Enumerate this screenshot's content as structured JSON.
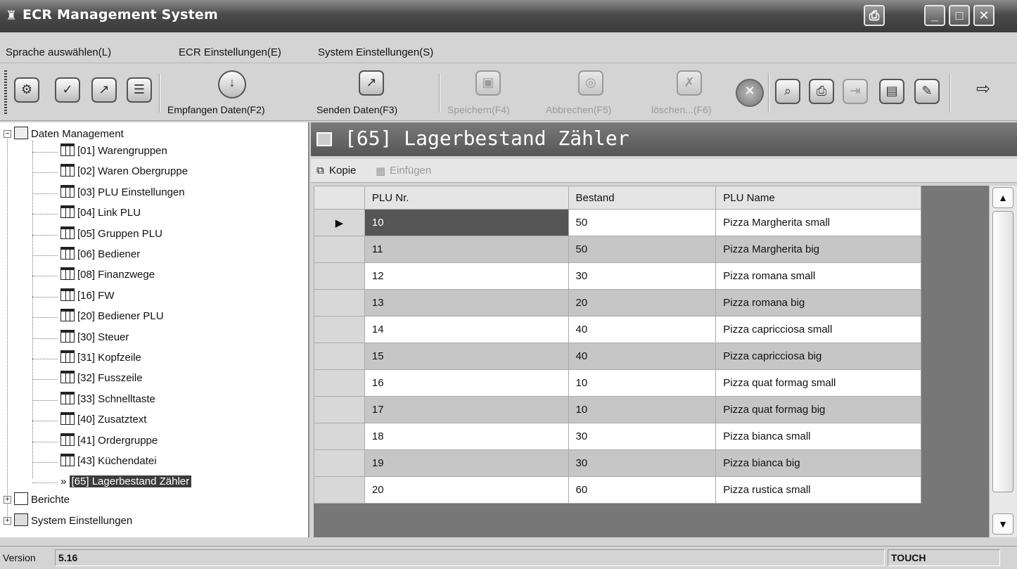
{
  "window": {
    "title": "ECR Management System"
  },
  "menu": [
    "Sprache auswählen(L)",
    "ECR Einstellungen(E)",
    "System Einstellungen(S)"
  ],
  "toolbar": {
    "receive_label": "Empfangen Daten(F2)",
    "send_label": "Senden Daten(F3)",
    "save_label": "Speichern(F4)",
    "cancel_label": "Abbrechen(F5)",
    "delete_label": "löschen...(F6)"
  },
  "tree": {
    "root_label": "Daten Management",
    "items": [
      "[01] Warengruppen",
      "[02] Waren Obergruppe",
      "[03] PLU Einstellungen",
      "[04] Link PLU",
      "[05] Gruppen PLU",
      "[06] Bediener",
      "[08] Finanzwege",
      "[16] FW",
      "[20] Bediener PLU",
      "[30] Steuer",
      "[31] Kopfzeile",
      "[32] Fusszeile",
      "[33] Schnelltaste",
      "[40] Zusatztext",
      "[41] Ordergruppe",
      "[43] Küchendatei"
    ],
    "selected_label": "[65] Lagerbestand Zähler",
    "selected_marker": "»",
    "reports_label": "Berichte",
    "system_label": "System Einstellungen"
  },
  "panel": {
    "title": "[65] Lagerbestand Zähler",
    "copy_label": "Kopie",
    "paste_label": "Einfügen"
  },
  "table": {
    "columns": [
      "PLU Nr.",
      "Bestand",
      "PLU Name"
    ],
    "rows": [
      [
        "10",
        "50",
        "Pizza Margherita small"
      ],
      [
        "11",
        "50",
        "Pizza Margherita big"
      ],
      [
        "12",
        "30",
        "Pizza romana small"
      ],
      [
        "13",
        "20",
        "Pizza romana big"
      ],
      [
        "14",
        "40",
        "Pizza capricciosa small"
      ],
      [
        "15",
        "40",
        "Pizza capricciosa big"
      ],
      [
        "16",
        "10",
        "Pizza quat formag  small"
      ],
      [
        "17",
        "10",
        "Pizza quat formag  big"
      ],
      [
        "18",
        "30",
        "Pizza bianca small"
      ],
      [
        "19",
        "30",
        "Pizza bianca big"
      ],
      [
        "20",
        "60",
        "Pizza rustica small"
      ]
    ],
    "current_row_marker": "▶"
  },
  "status": {
    "version_label": "Version",
    "version": "5.16",
    "mode": "TOUCH"
  }
}
